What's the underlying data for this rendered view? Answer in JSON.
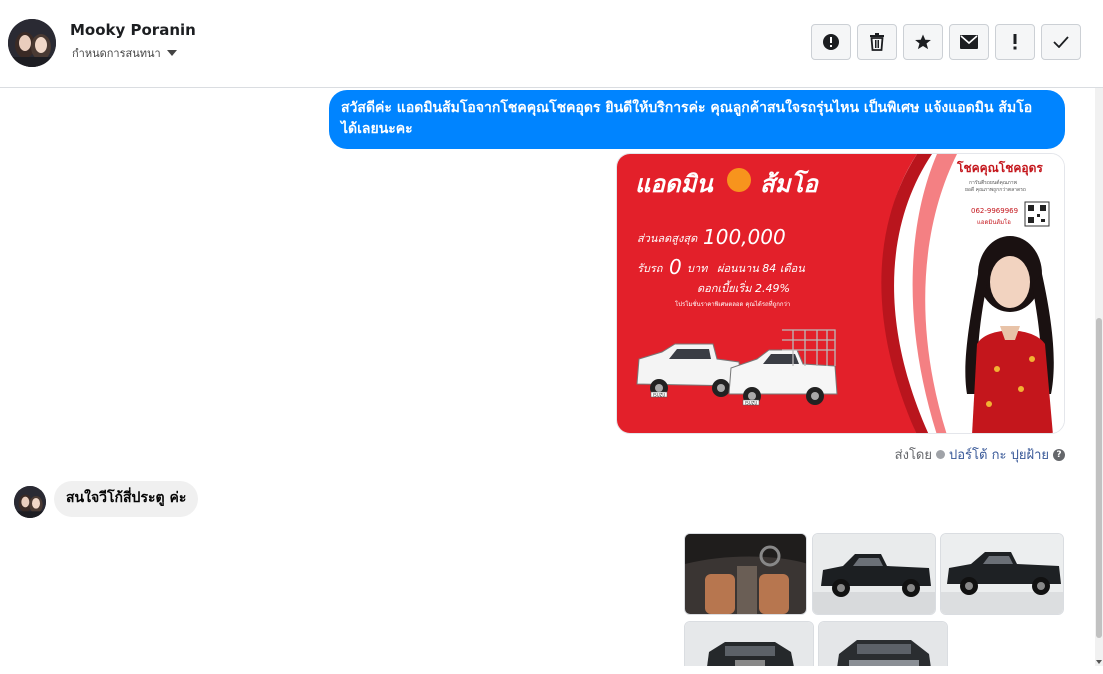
{
  "header": {
    "name": "Mooky Poranin",
    "subtitle": "กำหนดการสนทนา",
    "tools": [
      {
        "name": "report-spam-button",
        "icon": "alert-circle-icon"
      },
      {
        "name": "delete-button",
        "icon": "trash-icon"
      },
      {
        "name": "star-button",
        "icon": "star-icon"
      },
      {
        "name": "mark-unread-button",
        "icon": "envelope-icon"
      },
      {
        "name": "follow-up-button",
        "icon": "exclamation-icon"
      },
      {
        "name": "mark-done-button",
        "icon": "check-icon"
      }
    ]
  },
  "messages": {
    "outgoing_text": "สวัสดีค่ะ แอดมินส้มโอจากโชคคุณโชคอุดร ยินดีให้บริการค่ะ   คุณลูกค้าสนใจรถรุ่นไหน เป็นพิเศษ แจ้งแอดมิน ส้มโอ ได้เลยนะคะ",
    "promo": {
      "brand": "แอดมิน",
      "brand2": "ส้มโอ",
      "discount_label": "ส่วนลดสูงสุด",
      "discount_value": "100,000",
      "down_label": "รับรถ",
      "down_value": "0",
      "down_unit": "บาท",
      "installment": "ผ่อนนาน 84 เดือน",
      "interest": "ดอกเบี้ยเริ่ม 2.49%",
      "fineprint": "โปรโมชั่นราคาพิเศษตลอด คุณได้รถที่ถูกกว่า",
      "dealer": "โชคคุณโชคอุดร",
      "dealer_sub": "การันตีรถยนต์คุณภาพ",
      "dealer_sub2": "ยอดี คุณภาพถูกกว่าตลาดรถ",
      "phone": "062-9969969",
      "admin_line": "แอดมินส้มโอ",
      "plate1": "ISUZU",
      "plate2": "ISUZU"
    },
    "sent_by_label": "ส่งโดย",
    "sent_by_name": "ปอร์โต้ กะ ปุยฝ้าย",
    "help_glyph": "?",
    "incoming_text": "สนใจวีโก้สี่ประตู ค่ะ"
  },
  "colors": {
    "accent": "#0084ff",
    "promo_red": "#e3202a",
    "incoming_bg": "#f0f0f0"
  }
}
